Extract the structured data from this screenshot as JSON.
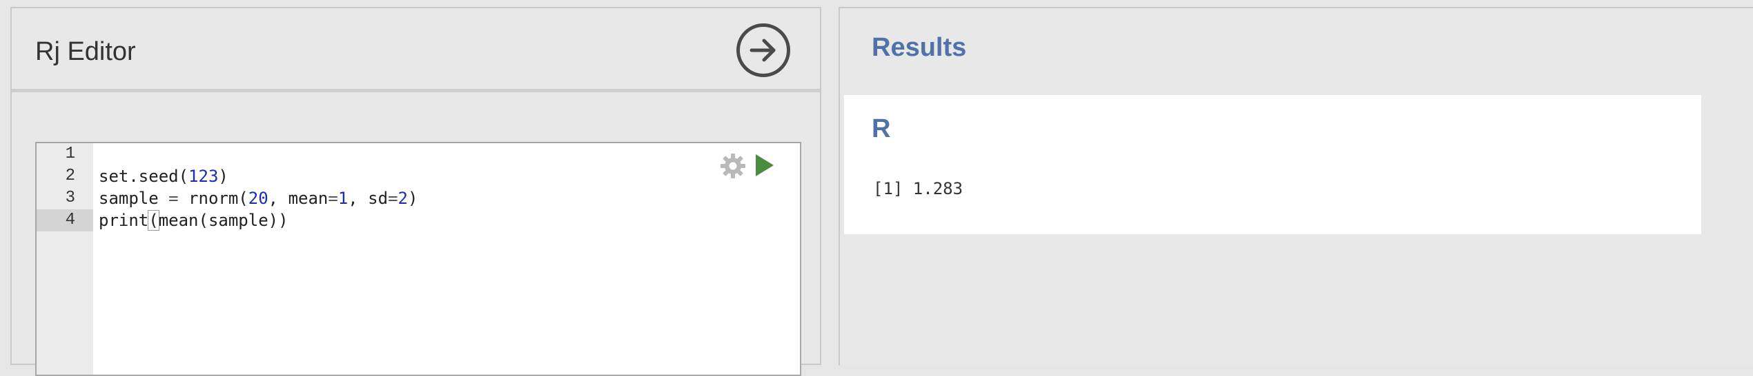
{
  "editor": {
    "title": "Rj Editor",
    "run_button_icon": "arrow-right-circle-icon",
    "settings_icon": "gear-icon",
    "play_icon": "play-icon",
    "line_numbers": [
      "1",
      "2",
      "3",
      "4"
    ],
    "active_line": "4",
    "code_lines": [
      "",
      "set.seed(123)",
      "sample = rnorm(20, mean=1, sd=2)",
      "print(mean(sample))"
    ],
    "code_tokens": {
      "l2": {
        "fn": "set.seed(",
        "num": "123",
        "close": ")"
      },
      "l3": {
        "a": "sample ",
        "eq": "=",
        "b": " rnorm(",
        "n1": "20",
        "c": ", mean",
        "eq2": "=",
        "n2": "1",
        "d": ", sd",
        "eq3": "=",
        "n3": "2",
        "e": ")"
      },
      "l4": {
        "a": "print",
        "b": "(",
        "c": "mean(sample))",
        "d": ")"
      }
    },
    "colors": {
      "number": "#1a2bb8",
      "play_green": "#4c8a3e",
      "gear_gray": "#b8b8b8"
    }
  },
  "results": {
    "title": "Results",
    "section_heading": "R",
    "output": "[1] 1.283",
    "colors": {
      "heading": "#4f72a8"
    }
  }
}
